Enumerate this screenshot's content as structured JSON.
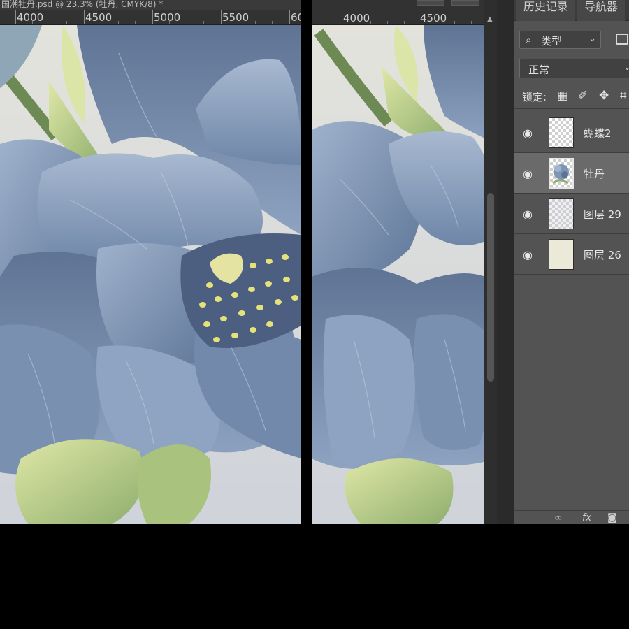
{
  "document": {
    "tab_title": "国潮牡丹.psd @ 23.3% (牡丹, CMYK/8) *"
  },
  "left_view": {
    "ruler_labels": [
      "4000",
      "4500",
      "5000",
      "5500",
      "60"
    ]
  },
  "right_view": {
    "ruler_labels": [
      "4000",
      "4500"
    ]
  },
  "panel": {
    "tabs": [
      "历史记录",
      "导航器"
    ],
    "filter": {
      "icon": "search-icon",
      "label": "类型"
    },
    "blend_mode": "正常",
    "lock_label": "锁定:",
    "layers": [
      {
        "name": "蝴蝶2",
        "visible": true,
        "selected": false,
        "thumb": "transparent-checker"
      },
      {
        "name": "牡丹",
        "visible": true,
        "selected": true,
        "thumb": "peony-thumbnail"
      },
      {
        "name": "图层 29",
        "visible": true,
        "selected": false,
        "thumb": "faint-texture"
      },
      {
        "name": "图层 26",
        "visible": true,
        "selected": false,
        "thumb": "cream-fill"
      }
    ],
    "bottom_icons": [
      "link-icon",
      "fx-icon",
      "mask-icon"
    ]
  },
  "colors": {
    "panel_bg": "#535353",
    "selected_layer_bg": "#6a6a6a",
    "petal_blue": "#7e94b4",
    "leaf_green": "#a9c27e",
    "stamen_yellow": "#e6e27a"
  }
}
